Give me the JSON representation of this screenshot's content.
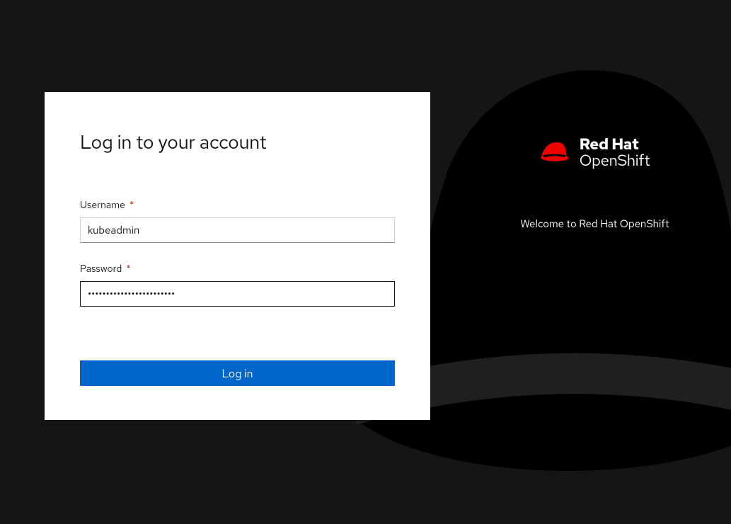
{
  "login": {
    "title": "Log in to your account",
    "username_label": "Username",
    "username_value": "kubeadmin",
    "password_label": "Password",
    "password_value": "••••••••••••••••••••••••",
    "button_label": "Log in",
    "required_marker": "*"
  },
  "brand": {
    "line1": "Red Hat",
    "line2": "OpenShift",
    "welcome": "Welcome to Red Hat OpenShift"
  }
}
